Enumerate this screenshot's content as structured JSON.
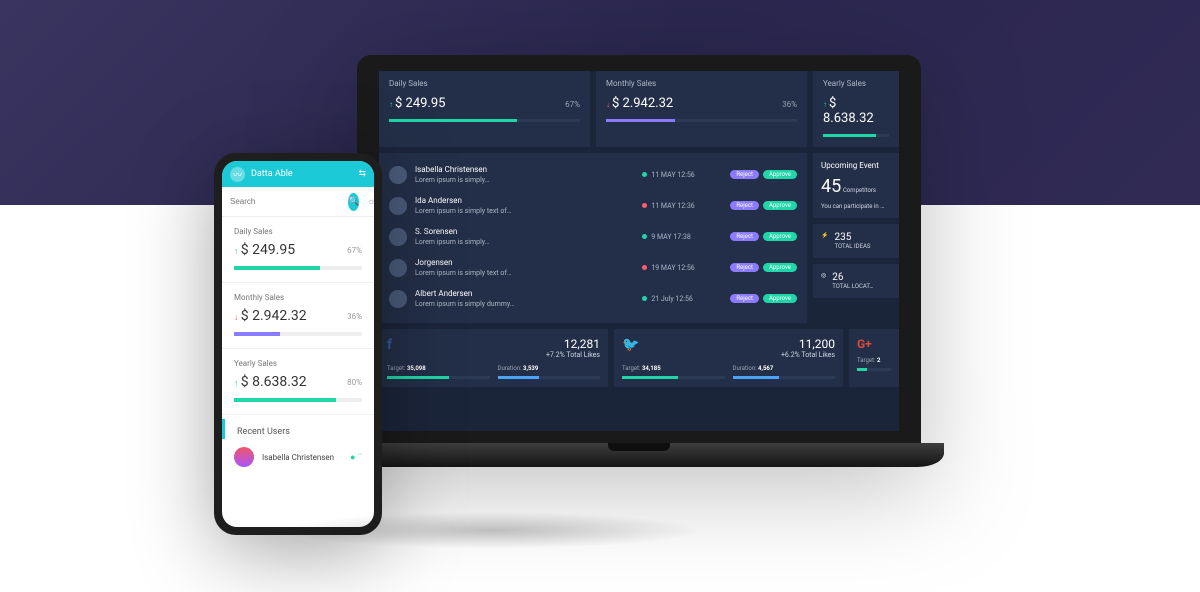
{
  "app_name": "Datta Able",
  "search_placeholder": "Search",
  "cards": {
    "daily": {
      "label": "Daily Sales",
      "value": "$ 249.95",
      "pct": "67%",
      "dir": "up",
      "bar_pct": 67,
      "color": "#1ed6a7"
    },
    "monthly": {
      "label": "Monthly Sales",
      "value": "$ 2.942.32",
      "pct": "36%",
      "dir": "down",
      "bar_pct": 36,
      "color": "#8b7bff"
    },
    "yearly": {
      "label": "Yearly Sales",
      "value": "$ 8.638.32",
      "pct": "80%",
      "dir": "up",
      "bar_pct": 80,
      "color": "#1ed6a7"
    }
  },
  "laptop_cards": {
    "daily": {
      "label": "Daily Sales",
      "pct_label": "67%"
    },
    "monthly": {
      "label": "Monthly Sales",
      "pct_label": "36%"
    },
    "yearly": {
      "label": "Yearly Sales"
    }
  },
  "recent_users_title": "Recent Users",
  "list": [
    {
      "name": "Isabella Christensen",
      "sub": "Lorem ipsum is simply…",
      "date": "11 MAY 12:56",
      "dot": "g"
    },
    {
      "name": "Ida Andersen",
      "sub": "Lorem ipsum is simply text of…",
      "date": "11 MAY 12:36",
      "dot": "r"
    },
    {
      "name": "S. Sorensen",
      "sub": "Lorem ipsum is simply…",
      "date": "9 MAY 17:38",
      "dot": "g"
    },
    {
      "name": "Jorgensen",
      "sub": "Lorem ipsum is simply text of…",
      "date": "19 MAY 12:56",
      "dot": "r"
    },
    {
      "name": "Albert Andersen",
      "sub": "Lorem ipsum is simply dummy…",
      "date": "21 July 12:56",
      "dot": "g"
    }
  ],
  "list_buttons": {
    "reject": "Reject",
    "approve": "Approve"
  },
  "upcoming": {
    "title": "Upcoming Event",
    "count": "45",
    "unit": "Competitors",
    "note": "You can participate in …"
  },
  "stats": {
    "ideas": {
      "value": "235",
      "label": "TOTAL IDEAS"
    },
    "locations": {
      "value": "26",
      "label": "TOTAL LOCAT…"
    }
  },
  "social": {
    "a": {
      "likes": "12,281",
      "change": "+7.2% Total Likes",
      "target_label": "Target:",
      "target": "35,098",
      "duration_label": "Duration:",
      "duration": "3,539"
    },
    "b": {
      "likes": "11,200",
      "change": "+6.2% Total Likes",
      "target_label": "Target:",
      "target": "34,185",
      "duration_label": "Duration:",
      "duration": "4,567"
    },
    "c": {
      "target_label": "Target:",
      "target": "2"
    }
  },
  "phone_user": {
    "name": "Isabella Christensen"
  }
}
